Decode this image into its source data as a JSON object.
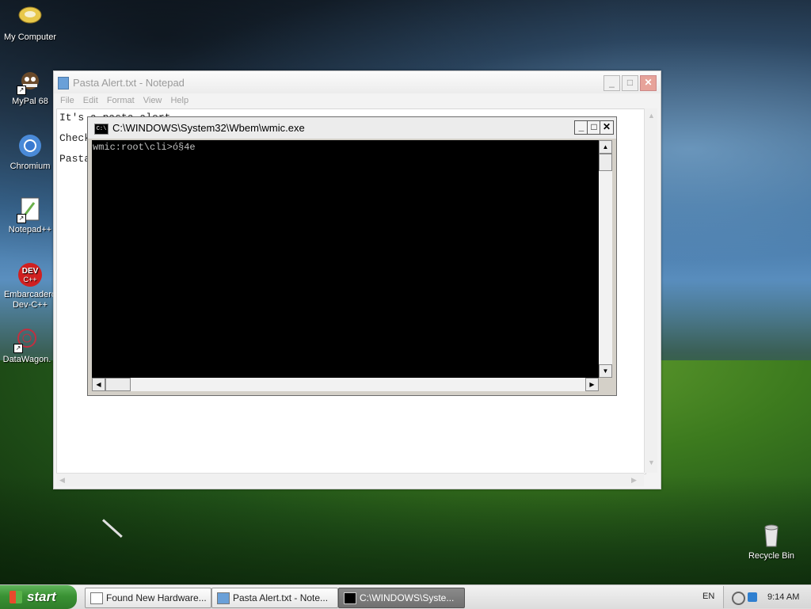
{
  "desktop": {
    "icons": [
      {
        "label": "My Computer"
      },
      {
        "label": "MyPal 68"
      },
      {
        "label": "Chromium"
      },
      {
        "label": "Notepad++"
      },
      {
        "label": "Embarcadero Dev-C++"
      },
      {
        "label": "DataWagon."
      },
      {
        "label": "Recycle Bin"
      }
    ]
  },
  "notepad": {
    "title": "Pasta Alert.txt - Notepad",
    "menu": [
      "File",
      "Edit",
      "Format",
      "View",
      "Help"
    ],
    "lines": [
      "It's a pasta alert",
      "Check",
      "Pasta"
    ]
  },
  "console": {
    "title": "C:\\WINDOWS\\System32\\Wbem\\wmic.exe",
    "output_line": "wmic:root\\cli>ó§4e"
  },
  "taskbar": {
    "start_label": "start",
    "tasks": [
      {
        "label": "Found New Hardware..."
      },
      {
        "label": "Pasta Alert.txt - Note..."
      },
      {
        "label": "C:\\WINDOWS\\Syste..."
      }
    ],
    "language": "EN",
    "clock": "9:14 AM"
  }
}
